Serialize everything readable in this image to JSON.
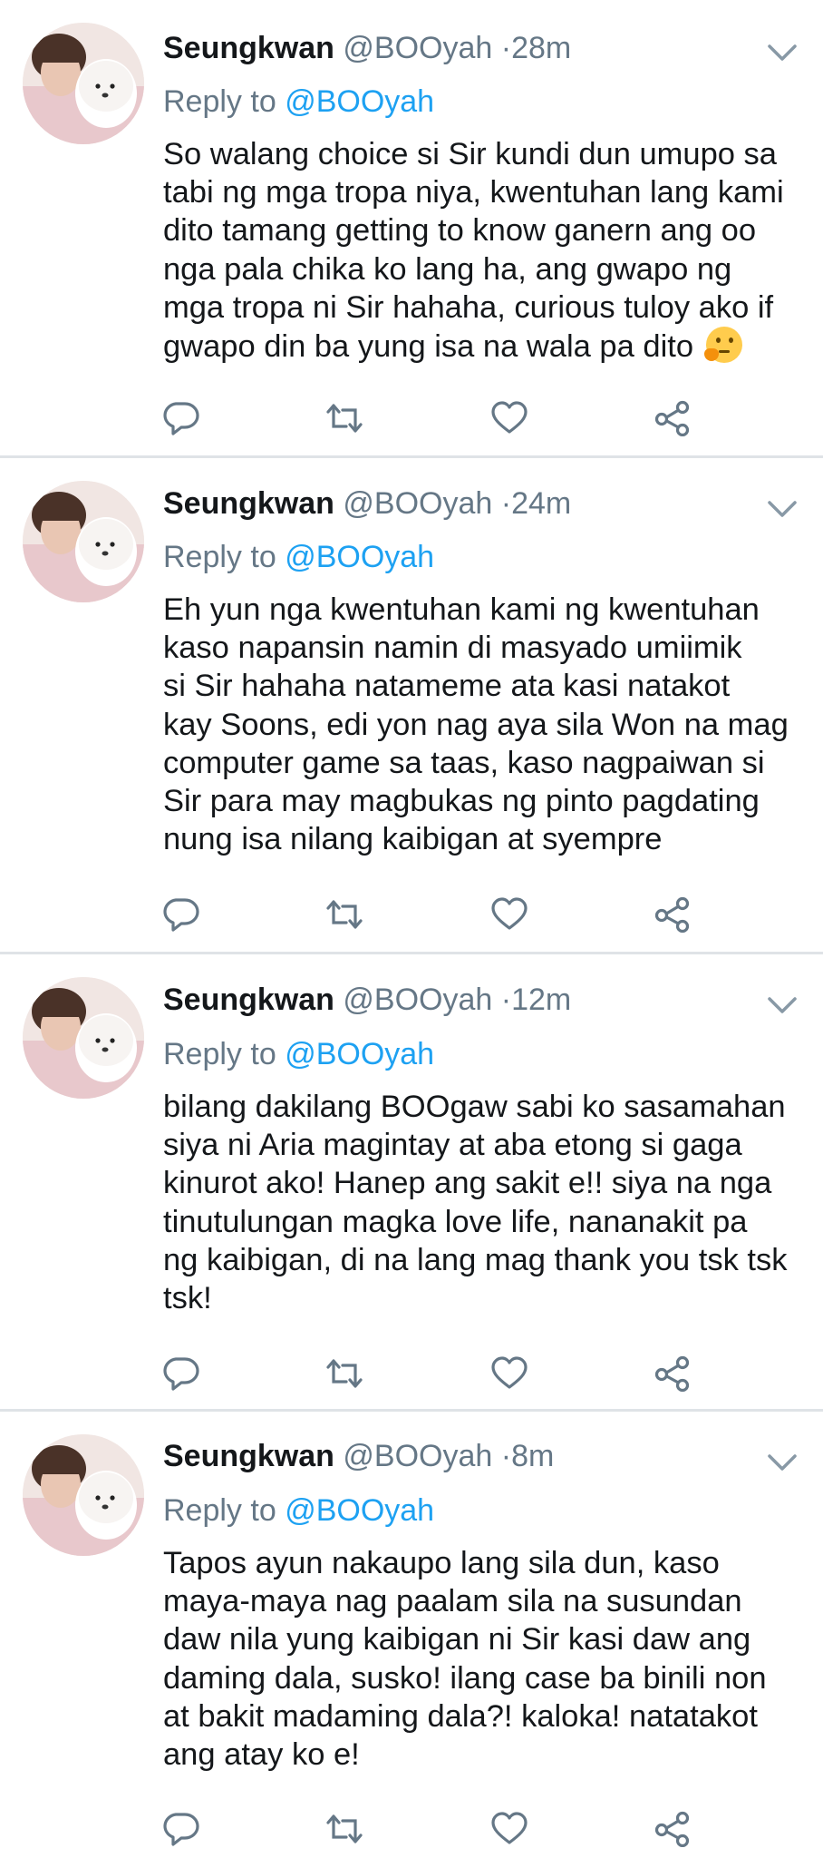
{
  "tweets": [
    {
      "name": "Seungkwan",
      "handle": "@BOOyah",
      "separator": "·",
      "time": "28m",
      "reply_prefix": "Reply to",
      "reply_handle": "@BOOyah",
      "lines": [
        "So walang choice si Sir kundi dun umupo sa",
        "tabi ng mga tropa niya,  kwentuhan lang kami",
        "dito tamang getting to know ganern ang oo",
        "nga pala chika ko lang ha, ang gwapo ng",
        "mga tropa ni Sir hahaha, curious tuloy ako if",
        "gwapo din ba yung isa na wala pa dito"
      ],
      "emoji": "thinking-face"
    },
    {
      "name": "Seungkwan",
      "handle": "@BOOyah",
      "separator": "·",
      "time": "24m",
      "reply_prefix": "Reply to",
      "reply_handle": "@BOOyah",
      "lines": [
        "Eh yun nga kwentuhan kami ng kwentuhan",
        "kaso napansin namin di masyado umiimik",
        "si Sir hahaha natameme ata kasi natakot",
        "kay Soons, edi yon nag aya sila Won na mag",
        "computer game sa taas, kaso nagpaiwan si",
        "Sir para may magbukas ng pinto pagdating",
        "nung isa nilang kaibigan at syempre"
      ]
    },
    {
      "name": "Seungkwan",
      "handle": "@BOOyah",
      "separator": "·",
      "time": "12m",
      "reply_prefix": "Reply to",
      "reply_handle": "@BOOyah",
      "lines": [
        "bilang dakilang BOOgaw sabi ko sasamahan",
        "siya ni Aria magintay at aba etong si gaga",
        "kinurot ako! Hanep ang sakit e!! siya na nga",
        "tinutulungan magka love life, nananakit pa",
        "ng kaibigan, di na lang mag thank you tsk tsk",
        "tsk!"
      ]
    },
    {
      "name": "Seungkwan",
      "handle": "@BOOyah",
      "separator": "·",
      "time": "8m",
      "reply_prefix": "Reply to",
      "reply_handle": "@BOOyah",
      "lines": [
        "Tapos ayun nakaupo lang sila dun, kaso",
        "maya-maya nag paalam sila na susundan",
        "daw nila yung kaibigan ni Sir kasi daw ang",
        "daming dala, susko! ilang case ba binili non",
        "at bakit madaming dala?! kaloka! natatakot",
        "ang atay ko e!"
      ]
    }
  ],
  "icons": {
    "reply": "reply-icon",
    "retweet": "retweet-icon",
    "like": "heart-icon",
    "share": "share-icon",
    "menu": "chevron-down-icon"
  },
  "colors": {
    "text": "#14171a",
    "secondary": "#657786",
    "link": "#1da1f2",
    "icon": "#657786",
    "divider": "#dfe3e7"
  }
}
